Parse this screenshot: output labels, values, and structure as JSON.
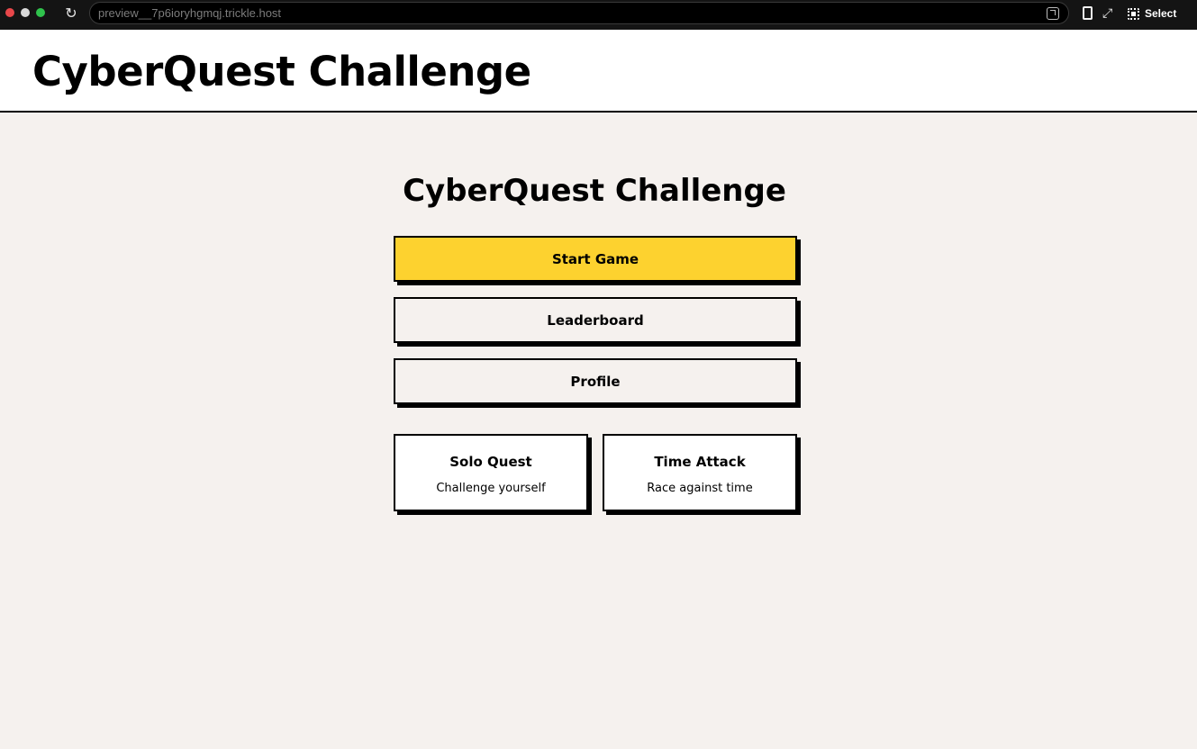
{
  "browser": {
    "url": "preview__7p6ioryhgmqj.trickle.host",
    "select_label": "Select"
  },
  "header": {
    "title": "CyberQuest Challenge"
  },
  "main": {
    "title": "CyberQuest Challenge",
    "buttons": [
      {
        "label": "Start Game"
      },
      {
        "label": "Leaderboard"
      },
      {
        "label": "Profile"
      }
    ],
    "modes": [
      {
        "title": "Solo Quest",
        "subtitle": "Challenge yourself"
      },
      {
        "title": "Time Attack",
        "subtitle": "Race against time"
      }
    ]
  },
  "colors": {
    "accent": "#fdd22f",
    "background": "#f5f1ee",
    "border": "#000000"
  }
}
